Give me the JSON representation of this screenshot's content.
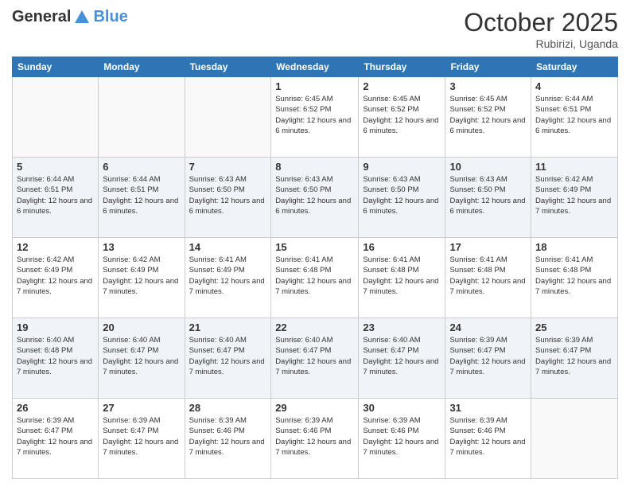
{
  "logo": {
    "general": "General",
    "blue": "Blue"
  },
  "title": "October 2025",
  "subtitle": "Rubirizi, Uganda",
  "days_header": [
    "Sunday",
    "Monday",
    "Tuesday",
    "Wednesday",
    "Thursday",
    "Friday",
    "Saturday"
  ],
  "weeks": [
    [
      {
        "day": "",
        "info": ""
      },
      {
        "day": "",
        "info": ""
      },
      {
        "day": "",
        "info": ""
      },
      {
        "day": "1",
        "info": "Sunrise: 6:45 AM\nSunset: 6:52 PM\nDaylight: 12 hours\nand 6 minutes."
      },
      {
        "day": "2",
        "info": "Sunrise: 6:45 AM\nSunset: 6:52 PM\nDaylight: 12 hours\nand 6 minutes."
      },
      {
        "day": "3",
        "info": "Sunrise: 6:45 AM\nSunset: 6:52 PM\nDaylight: 12 hours\nand 6 minutes."
      },
      {
        "day": "4",
        "info": "Sunrise: 6:44 AM\nSunset: 6:51 PM\nDaylight: 12 hours\nand 6 minutes."
      }
    ],
    [
      {
        "day": "5",
        "info": "Sunrise: 6:44 AM\nSunset: 6:51 PM\nDaylight: 12 hours\nand 6 minutes."
      },
      {
        "day": "6",
        "info": "Sunrise: 6:44 AM\nSunset: 6:51 PM\nDaylight: 12 hours\nand 6 minutes."
      },
      {
        "day": "7",
        "info": "Sunrise: 6:43 AM\nSunset: 6:50 PM\nDaylight: 12 hours\nand 6 minutes."
      },
      {
        "day": "8",
        "info": "Sunrise: 6:43 AM\nSunset: 6:50 PM\nDaylight: 12 hours\nand 6 minutes."
      },
      {
        "day": "9",
        "info": "Sunrise: 6:43 AM\nSunset: 6:50 PM\nDaylight: 12 hours\nand 6 minutes."
      },
      {
        "day": "10",
        "info": "Sunrise: 6:43 AM\nSunset: 6:50 PM\nDaylight: 12 hours\nand 6 minutes."
      },
      {
        "day": "11",
        "info": "Sunrise: 6:42 AM\nSunset: 6:49 PM\nDaylight: 12 hours\nand 7 minutes."
      }
    ],
    [
      {
        "day": "12",
        "info": "Sunrise: 6:42 AM\nSunset: 6:49 PM\nDaylight: 12 hours\nand 7 minutes."
      },
      {
        "day": "13",
        "info": "Sunrise: 6:42 AM\nSunset: 6:49 PM\nDaylight: 12 hours\nand 7 minutes."
      },
      {
        "day": "14",
        "info": "Sunrise: 6:41 AM\nSunset: 6:49 PM\nDaylight: 12 hours\nand 7 minutes."
      },
      {
        "day": "15",
        "info": "Sunrise: 6:41 AM\nSunset: 6:48 PM\nDaylight: 12 hours\nand 7 minutes."
      },
      {
        "day": "16",
        "info": "Sunrise: 6:41 AM\nSunset: 6:48 PM\nDaylight: 12 hours\nand 7 minutes."
      },
      {
        "day": "17",
        "info": "Sunrise: 6:41 AM\nSunset: 6:48 PM\nDaylight: 12 hours\nand 7 minutes."
      },
      {
        "day": "18",
        "info": "Sunrise: 6:41 AM\nSunset: 6:48 PM\nDaylight: 12 hours\nand 7 minutes."
      }
    ],
    [
      {
        "day": "19",
        "info": "Sunrise: 6:40 AM\nSunset: 6:48 PM\nDaylight: 12 hours\nand 7 minutes."
      },
      {
        "day": "20",
        "info": "Sunrise: 6:40 AM\nSunset: 6:47 PM\nDaylight: 12 hours\nand 7 minutes."
      },
      {
        "day": "21",
        "info": "Sunrise: 6:40 AM\nSunset: 6:47 PM\nDaylight: 12 hours\nand 7 minutes."
      },
      {
        "day": "22",
        "info": "Sunrise: 6:40 AM\nSunset: 6:47 PM\nDaylight: 12 hours\nand 7 minutes."
      },
      {
        "day": "23",
        "info": "Sunrise: 6:40 AM\nSunset: 6:47 PM\nDaylight: 12 hours\nand 7 minutes."
      },
      {
        "day": "24",
        "info": "Sunrise: 6:39 AM\nSunset: 6:47 PM\nDaylight: 12 hours\nand 7 minutes."
      },
      {
        "day": "25",
        "info": "Sunrise: 6:39 AM\nSunset: 6:47 PM\nDaylight: 12 hours\nand 7 minutes."
      }
    ],
    [
      {
        "day": "26",
        "info": "Sunrise: 6:39 AM\nSunset: 6:47 PM\nDaylight: 12 hours\nand 7 minutes."
      },
      {
        "day": "27",
        "info": "Sunrise: 6:39 AM\nSunset: 6:47 PM\nDaylight: 12 hours\nand 7 minutes."
      },
      {
        "day": "28",
        "info": "Sunrise: 6:39 AM\nSunset: 6:46 PM\nDaylight: 12 hours\nand 7 minutes."
      },
      {
        "day": "29",
        "info": "Sunrise: 6:39 AM\nSunset: 6:46 PM\nDaylight: 12 hours\nand 7 minutes."
      },
      {
        "day": "30",
        "info": "Sunrise: 6:39 AM\nSunset: 6:46 PM\nDaylight: 12 hours\nand 7 minutes."
      },
      {
        "day": "31",
        "info": "Sunrise: 6:39 AM\nSunset: 6:46 PM\nDaylight: 12 hours\nand 7 minutes."
      },
      {
        "day": "",
        "info": ""
      }
    ]
  ]
}
